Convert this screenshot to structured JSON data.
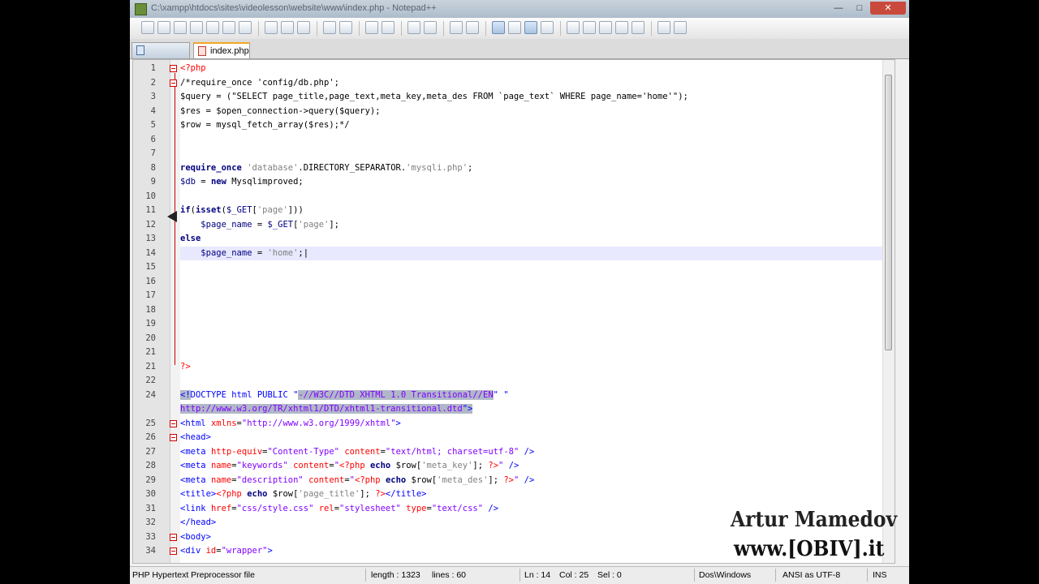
{
  "window": {
    "title": "C:\\xampp\\htdocs\\sites\\videolesson\\website\\www\\index.php - Notepad++",
    "min_label": "—",
    "max_label": "□",
    "close_label": "✕"
  },
  "tabs": [
    {
      "label": ""
    },
    {
      "label": "index.php"
    }
  ],
  "code_lines": [
    {
      "n": "1",
      "html": "<span class='php'>&lt;?php</span>"
    },
    {
      "n": "2",
      "html": "<span class='c'>/*require_once 'config/db.php';</span>"
    },
    {
      "n": "3",
      "html": "<span class='c'>$query = (\"SELECT page_title,page_text,meta_key,meta_des FROM `page_text` WHERE page_name='home'\");</span>"
    },
    {
      "n": "4",
      "html": "<span class='c'>$res = $open_connection-&gt;query($query);</span>"
    },
    {
      "n": "5",
      "html": "<span class='c'>$row = mysql_fetch_array($res);*/</span>"
    },
    {
      "n": "6",
      "html": ""
    },
    {
      "n": "7",
      "html": ""
    },
    {
      "n": "8",
      "html": "<span class='k'>require_once</span> <span class='s'>'database'</span>.DIRECTORY_SEPARATOR.<span class='s'>'mysqli.php'</span>;"
    },
    {
      "n": "9",
      "html": "<span class='v'>$db</span> = <span class='k'>new</span> Mysqlimproved;"
    },
    {
      "n": "10",
      "html": ""
    },
    {
      "n": "11",
      "html": "<span class='k'>if</span>(<span class='k'>isset</span>(<span class='v'>$_GET</span>[<span class='s'>'page'</span>]))"
    },
    {
      "n": "12",
      "html": "    <span class='v'>$page_name</span> = <span class='v'>$_GET</span>[<span class='s'>'page'</span>];"
    },
    {
      "n": "13",
      "html": "<span class='k'>else</span>"
    },
    {
      "n": "14",
      "html": "    <span class='v'>$page_name</span> = <span class='s'>'home'</span>;|",
      "current": true
    },
    {
      "n": "15",
      "html": ""
    },
    {
      "n": "16",
      "html": ""
    },
    {
      "n": "17",
      "html": ""
    },
    {
      "n": "18",
      "html": ""
    },
    {
      "n": "19",
      "html": ""
    },
    {
      "n": "20",
      "html": ""
    },
    {
      "n": "21",
      "html": ""
    },
    {
      "n": "21",
      "html": "<span class='php'>?&gt;</span>"
    },
    {
      "n": "22",
      "html": ""
    },
    {
      "n": "24",
      "html": "<span class='html sel'>&lt;!</span><span class='html'>DOCTYPE html PUBLIC \"</span><span class='val sel'>-//W3C//DTD XHTML 1.0 Transitional//EN</span><span class='html'>\" \"</span>",
      "line2": "<span class='val sel'>http://www.w3.org/TR/xhtml1/DTD/xhtml1-transitional.dtd</span><span class='html sel'>\"&gt;</span>"
    },
    {
      "n": "25",
      "html": "<span class='html'>&lt;html </span><span class='attr'>xmlns</span>=<span class='val'>\"http://www.w3.org/1999/xhtml\"</span><span class='html'>&gt;</span>",
      "fold": true
    },
    {
      "n": "26",
      "html": "<span class='html'>&lt;head&gt;</span>",
      "fold": true
    },
    {
      "n": "27",
      "html": "<span class='html'>&lt;meta </span><span class='attr'>http-equiv</span>=<span class='val'>\"Content-Type\"</span> <span class='attr'>content</span>=<span class='val'>\"text/html; charset=utf-8\"</span> <span class='html'>/&gt;</span>"
    },
    {
      "n": "28",
      "html": "<span class='html'>&lt;meta </span><span class='attr'>name</span>=<span class='val'>\"keywords\"</span> <span class='attr'>content</span>=<span class='val'>\"</span><span class='php'>&lt;?php</span> <span class='k'>echo</span> $row[<span class='s'>'meta_key'</span>]; <span class='php'>?&gt;</span><span class='val'>\"</span> <span class='html'>/&gt;</span>"
    },
    {
      "n": "29",
      "html": "<span class='html'>&lt;meta </span><span class='attr'>name</span>=<span class='val'>\"description\"</span> <span class='attr'>content</span>=<span class='val'>\"</span><span class='php'>&lt;?php</span> <span class='k'>echo</span> $row[<span class='s'>'meta_des'</span>]; <span class='php'>?&gt;</span><span class='val'>\"</span> <span class='html'>/&gt;</span>"
    },
    {
      "n": "30",
      "html": "<span class='html'>&lt;title&gt;</span><span class='php'>&lt;?php</span> <span class='k'>echo</span> $row[<span class='s'>'page_title'</span>]; <span class='php'>?&gt;</span><span class='html'>&lt;/title&gt;</span>"
    },
    {
      "n": "31",
      "html": "<span class='html'>&lt;link </span><span class='attr'>href</span>=<span class='val'>\"css/style.css\"</span> <span class='attr'>rel</span>=<span class='val'>\"stylesheet\"</span> <span class='attr'>type</span>=<span class='val'>\"text/css\"</span> <span class='html'>/&gt;</span>"
    },
    {
      "n": "32",
      "html": "<span class='html'>&lt;/head&gt;</span>"
    },
    {
      "n": "33",
      "html": "<span class='html'>&lt;body&gt;</span>",
      "fold": true
    },
    {
      "n": "34",
      "html": "<span class='html'>&lt;div </span><span class='attr'>id</span>=<span class='val'>\"wrapper\"</span><span class='html'>&gt;</span>",
      "fold": true
    }
  ],
  "status": {
    "filetype": "PHP Hypertext Preprocessor file",
    "length": "length : 1323",
    "lines": "lines : 60",
    "ln": "Ln : 14",
    "col": "Col : 25",
    "sel": "Sel : 0",
    "eol": "Dos\\Windows",
    "encoding": "ANSI as UTF-8",
    "mode": "INS"
  },
  "watermark": {
    "line1": "Artur Mamedov",
    "line2": "www.[OBIV].it"
  },
  "colors": {
    "keyword": "#000080",
    "string": "#808080",
    "html_tag": "#0000ff",
    "php_tag": "#ff0000",
    "selection": "#b0b8c8",
    "current_line": "#e8e8ff"
  }
}
